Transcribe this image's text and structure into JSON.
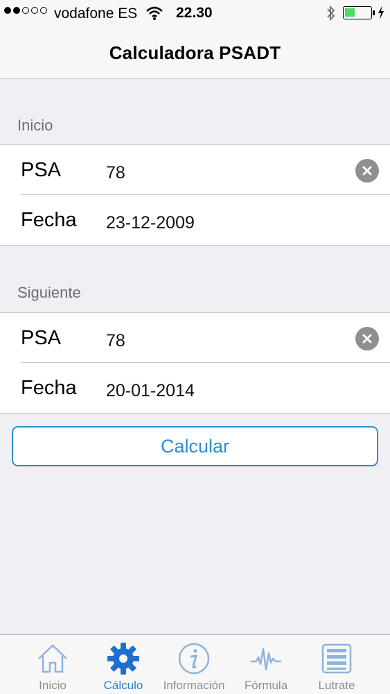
{
  "status_bar": {
    "carrier": "vodafone ES",
    "time": "22.30",
    "battery_level": 0.4
  },
  "nav": {
    "title": "Calculadora PSADT"
  },
  "sections": [
    {
      "header": "Inicio",
      "psa_label": "PSA",
      "psa_value": "78",
      "fecha_label": "Fecha",
      "fecha_value": "23-12-2009"
    },
    {
      "header": "Siguiente",
      "psa_label": "PSA",
      "psa_value": "78",
      "fecha_label": "Fecha",
      "fecha_value": "20-01-2014"
    }
  ],
  "calc_button": {
    "label": "Calcular"
  },
  "tabs": [
    {
      "label": "Inicio",
      "icon": "home-icon"
    },
    {
      "label": "Cálculo",
      "icon": "gear-icon",
      "active": true
    },
    {
      "label": "Información",
      "icon": "info-icon"
    },
    {
      "label": "Fórmula",
      "icon": "waveform-icon"
    },
    {
      "label": "Lutrate",
      "icon": "list-icon"
    }
  ],
  "colors": {
    "accent": "#2a8dd4",
    "background": "#efeff4",
    "inactive_tab": "#8e8e93"
  }
}
